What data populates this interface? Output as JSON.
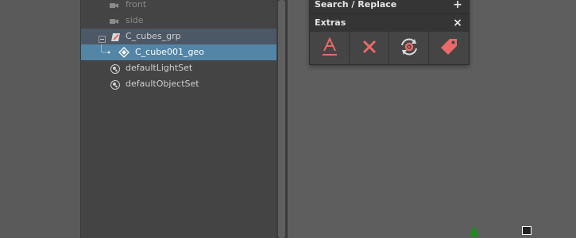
{
  "outliner": {
    "items": [
      {
        "label": "front",
        "icon": "camera-icon",
        "dim": true
      },
      {
        "label": "side",
        "icon": "camera-icon",
        "dim": true
      },
      {
        "label": "C_cubes_grp",
        "icon": "group-transform-icon",
        "expand": "minus"
      },
      {
        "label": "C_cube001_geo",
        "icon": "mesh-icon",
        "selected": true
      },
      {
        "label": "defaultLightSet",
        "icon": "set-icon"
      },
      {
        "label": "defaultObjectSet",
        "icon": "set-icon"
      }
    ]
  },
  "tool_panel": {
    "search_replace": {
      "title": "Search / Replace",
      "action": "+"
    },
    "extras": {
      "title": "Extras",
      "close": "×",
      "buttons": [
        {
          "icon": "text-format-icon",
          "color": "#e86a6a"
        },
        {
          "icon": "delete-x-icon",
          "color": "#e86a6a"
        },
        {
          "icon": "cycle-settings-icon",
          "color": "#e86a6a"
        },
        {
          "icon": "tag-icon",
          "color": "#e86a6a"
        }
      ]
    }
  },
  "colors": {
    "selection": "#5285a6",
    "group_row": "#4d5866",
    "accent_icon": "#e86a6a"
  }
}
